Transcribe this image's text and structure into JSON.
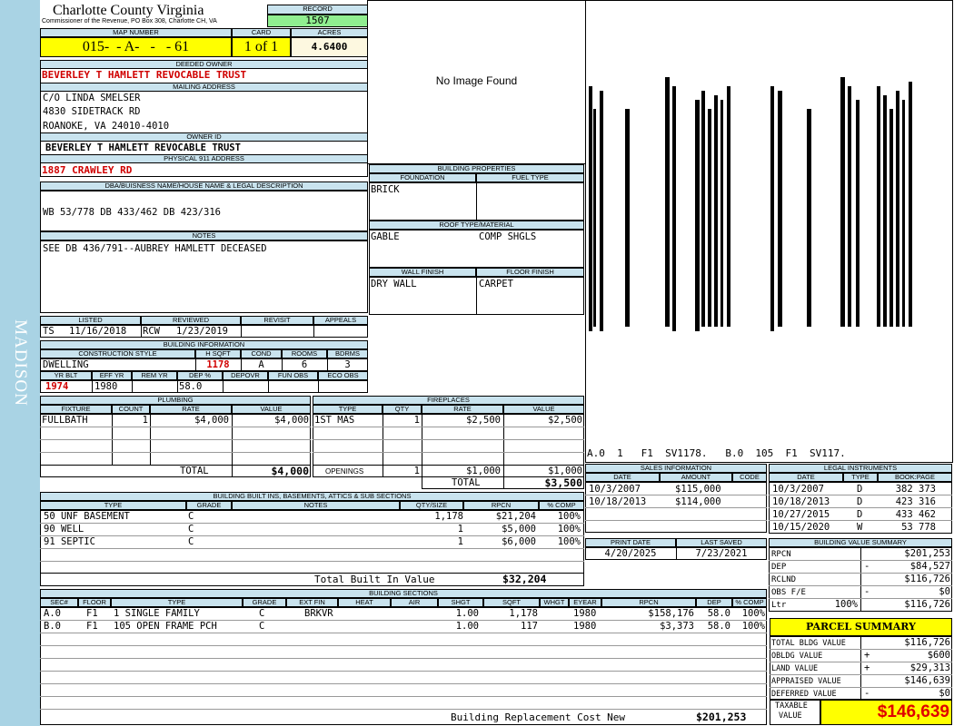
{
  "side_label": "MADISON",
  "header": {
    "county": "Charlotte County Virginia",
    "commissioner": "Commissioner of the Revenue, PO Box 308, Charlotte CH, VA",
    "record_label": "RECORD",
    "record": "1507",
    "map_label": "MAP NUMBER",
    "map_number": "015-  - A-   -   - 61",
    "card_label": "CARD",
    "card": "1 of 1",
    "acres_label": "ACRES",
    "acres": "4.6400"
  },
  "owner": {
    "deeded_label": "DEEDED OWNER",
    "deeded": "BEVERLEY T HAMLETT REVOCABLE TRUST",
    "mailing_label": "MAILING ADDRESS",
    "mail1": "C/O LINDA SMELSER",
    "mail2": "4830 SIDETRACK RD",
    "mail3": "ROANOKE, VA 24010-4010",
    "owner_id_label": "OWNER ID",
    "owner_id": "BEVERLEY T HAMLETT REVOCABLE TRUST",
    "addr_label": "PHYSICAL 911 ADDRESS",
    "addr": "1887 CRAWLEY RD"
  },
  "legal": {
    "label": "DBA/BUISNESS NAME/HOUSE NAME & LEGAL DESCRIPTION",
    "text": "WB 53/778 DB 433/462 DB 423/316"
  },
  "notes": {
    "label": "NOTES",
    "text": "SEE DB 436/791--AUBREY HAMLETT DECEASED"
  },
  "image": {
    "no_image": "No Image Found"
  },
  "building_props": {
    "label": "BUILDING PROPERTIES",
    "foundation_label": "FOUNDATION",
    "fuel_label": "FUEL TYPE",
    "foundation": "BRICK",
    "fuel": "",
    "roof_label": "ROOF TYPE/MATERIAL",
    "roof1": "GABLE",
    "roof2": "COMP SHGLS",
    "wall_label": "WALL FINISH",
    "floor_label": "FLOOR FINISH",
    "wall": "DRY WALL",
    "floor": "CARPET"
  },
  "sketch": {
    "caption": "A.0  1   F1  SV1178.   B.0  105  F1  SV117."
  },
  "listing": {
    "listed_label": "LISTED",
    "reviewed_label": "REVIEWED",
    "revisit_label": "REVISIT",
    "appeals_label": "APPEALS",
    "listed_by": "TS",
    "listed_date": "11/16/2018",
    "reviewed_by": "RCW",
    "reviewed_date": "1/23/2019"
  },
  "bldg_info": {
    "label": "BUILDING INFORMATION",
    "style_label": "CONSTRUCTION STYLE",
    "hsqft_label": "H SQFT",
    "cond_label": "COND",
    "rooms_label": "ROOMS",
    "bdrms_label": "BDRMS",
    "style": "DWELLING",
    "hsqft": "1178",
    "cond": "A",
    "rooms": "6",
    "bdrms": "3",
    "yrblt_label": "YR BLT",
    "effyr_label": "EFF YR",
    "remyr_label": "REM YR",
    "dep_label": "DEP %",
    "depovr_label": "DEPOVR",
    "funobs_label": "FUN OBS",
    "ecoobs_label": "ECO OBS",
    "yrblt": "1974",
    "effyr": "1980",
    "dep": "58.0"
  },
  "plumbing": {
    "label": "PLUMBING",
    "cols": [
      "FIXTURE",
      "COUNT",
      "RATE",
      "VALUE"
    ],
    "fixture": "FULLBATH",
    "count": "1",
    "rate": "$4,000",
    "value": "$4,000",
    "total_label": "TOTAL",
    "total": "$4,000"
  },
  "fireplaces": {
    "label": "FIREPLACES",
    "cols": [
      "TYPE",
      "QTY",
      "RATE",
      "VALUE"
    ],
    "type": "1ST MAS",
    "qty": "1",
    "rate": "$2,500",
    "value": "$2,500",
    "openings_label": "OPENINGS",
    "op_qty": "1",
    "op_rate": "$1,000",
    "op_value": "$1,000",
    "total_label": "TOTAL",
    "total": "$3,500"
  },
  "sales": {
    "label": "SALES INFORMATION",
    "cols": [
      "DATE",
      "AMOUNT",
      "CODE"
    ],
    "rows": [
      {
        "date": "10/3/2007",
        "amount": "$115,000"
      },
      {
        "date": "10/18/2013",
        "amount": "$114,000"
      }
    ]
  },
  "legal_inst": {
    "label": "LEGAL INSTRUMENTS",
    "cols": [
      "DATE",
      "TYPE",
      "BOOK:PAGE"
    ],
    "rows": [
      {
        "date": "10/3/2007",
        "type": "D",
        "bp": "382 373"
      },
      {
        "date": "10/18/2013",
        "type": "D",
        "bp": "423 316"
      },
      {
        "date": "10/27/2015",
        "type": "D",
        "bp": "433 462"
      },
      {
        "date": "10/15/2020",
        "type": "W",
        "bp": "53 778"
      }
    ]
  },
  "builtins": {
    "label": "BUILDING BUILT INS, BASEMENTS, ATTICS & SUB SECTIONS",
    "cols": [
      "TYPE",
      "GRADE",
      "NOTES",
      "QTY/SIZE",
      "RPCN",
      "% COMP"
    ],
    "rows": [
      {
        "type": "50 UNF BASEMENT",
        "grade": "C",
        "qty": "1,178",
        "rpcn": "$21,204",
        "comp": "100%"
      },
      {
        "type": "90 WELL",
        "grade": "C",
        "qty": "1",
        "rpcn": "$5,000",
        "comp": "100%"
      },
      {
        "type": "91 SEPTIC",
        "grade": "C",
        "qty": "1",
        "rpcn": "$6,000",
        "comp": "100%"
      }
    ],
    "total_label": "Total Built In Value",
    "total": "$32,204"
  },
  "dates": {
    "print_label": "PRINT DATE",
    "saved_label": "LAST SAVED",
    "print": "4/20/2025",
    "saved": "7/23/2021"
  },
  "bvs": {
    "label": "BUILDING VALUE SUMMARY",
    "rpcn_label": "RPCN",
    "rpcn": "$201,253",
    "dep_label": "DEP",
    "dep_sign": "-",
    "dep": "$84,527",
    "rclnd_label": "RCLND",
    "rclnd": "$116,726",
    "obs_label": "OBS F/E",
    "obs_sign": "-",
    "obs": "$0",
    "ltr_label": "Ltr",
    "ltr_pct": "100%",
    "ltr": "$116,726"
  },
  "sections": {
    "label": "BUILDING SECTIONS",
    "cols": [
      "SEC#",
      "FLOOR",
      "TYPE",
      "GRADE",
      "EXT FIN",
      "HEAT",
      "AIR",
      "SHGT",
      "SQFT",
      "WHGT",
      "EYEAR",
      "RPCN",
      "DEP",
      "% COMP"
    ],
    "rows": [
      {
        "sec": "A.0",
        "floor": "F1",
        "type": "1 SINGLE FAMILY",
        "grade": "C",
        "ext": "BRKVR",
        "shgt": "1.00",
        "sqft": "1,178",
        "eyear": "1980",
        "rpcn": "$158,176",
        "dep": "58.0",
        "comp": "100%"
      },
      {
        "sec": "B.0",
        "floor": "F1",
        "type": "105 OPEN FRAME PCH",
        "grade": "C",
        "ext": "",
        "shgt": "1.00",
        "sqft": "117",
        "eyear": "1980",
        "rpcn": "$3,373",
        "dep": "58.0",
        "comp": "100%"
      }
    ],
    "brcn_label": "Building Replacement Cost New",
    "brcn": "$201,253"
  },
  "parcel": {
    "label": "PARCEL SUMMARY",
    "tbv_label": "TOTAL BLDG VALUE",
    "tbv": "$116,726",
    "obldg_label": "OBLDG VALUE",
    "obldg_sign": "+",
    "obldg": "$600",
    "land_label": "LAND VALUE",
    "land_sign": "+",
    "land": "$29,313",
    "appr_label": "APPRAISED VALUE",
    "appr": "$146,639",
    "def_label": "DEFERRED VALUE",
    "def_sign": "-",
    "def": "$0",
    "taxable_label1": "TAXABLE",
    "taxable_label2": "VALUE",
    "taxable": "$146,639"
  }
}
